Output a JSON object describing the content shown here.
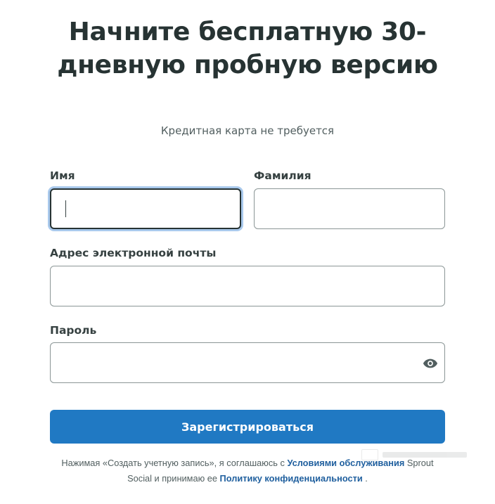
{
  "header": {
    "title": "Начните бесплатную 30-дневную пробную версию",
    "subtitle": "Кредитная карта не требуется"
  },
  "form": {
    "first_name": {
      "label": "Имя",
      "value": "",
      "focused": true
    },
    "last_name": {
      "label": "Фамилия",
      "value": ""
    },
    "email": {
      "label": "Адрес электронной почты",
      "value": ""
    },
    "password": {
      "label": "Пароль",
      "value": "",
      "toggle_icon": "eye-icon"
    },
    "submit_label": "Зарегистрироваться"
  },
  "legal": {
    "text_before": "Нажимая «Создать учетную запись», я соглашаюсь с ",
    "terms_link": "Условиями обслуживания",
    "text_middle": " Sprout Social и принимаю ее ",
    "privacy_link": "Политику конфиденциальности",
    "text_after": " ."
  },
  "colors": {
    "primary_button": "#2079c3",
    "link": "#1f5f9e",
    "heading": "#273333",
    "focus_ring": "#a9c9ec"
  }
}
